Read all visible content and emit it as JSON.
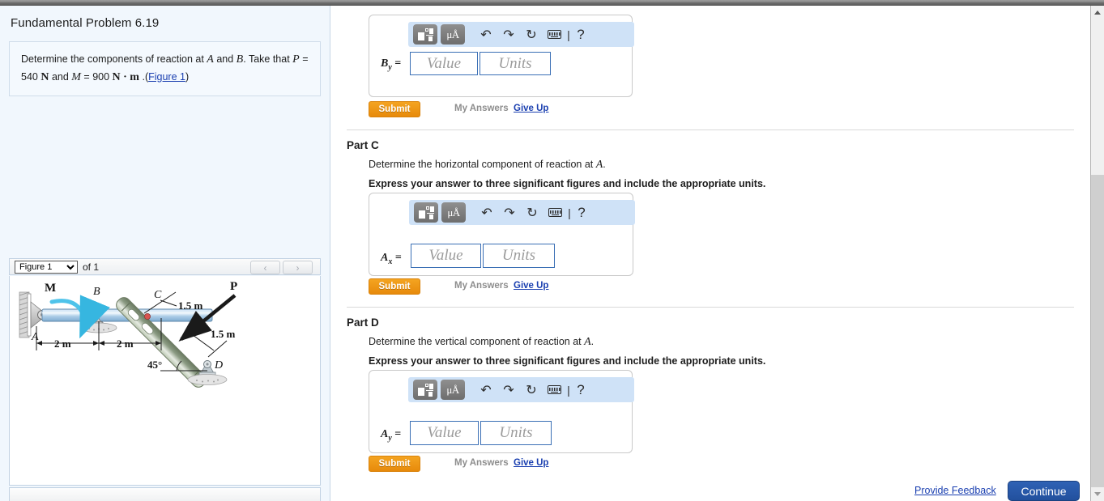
{
  "window": {
    "scrollbar": {
      "up_icon": "chevron-up-icon",
      "down_icon": "chevron-down-icon"
    }
  },
  "left_panel": {
    "problem_title": "Fundamental Problem 6.19",
    "problem_statement_html": "Determine the components of reaction at <span class=\"mvar\">A</span> and <span class=\"mvar\">B</span>. Take that <span class=\"mvar\">P</span> = 540 <span class=\"mbold\">N</span> and <span class=\"mvar\">M</span> = 900 <span class=\"mbold\">N &middot; m</span> .",
    "figure_link_label": "Figure 1",
    "figure_link_open": "(",
    "figure_link_close": ")",
    "figure_select_value": "Figure 1",
    "figure_select_options": [
      "Figure 1"
    ],
    "figure_count_label": "of 1",
    "prev_figure_icon": "chevron-left-icon",
    "next_figure_icon": "chevron-right-icon",
    "figure": {
      "labels": {
        "moment": "M",
        "point_a": "A",
        "point_b": "B",
        "point_c": "C",
        "point_d": "D",
        "force_p": "P",
        "dim_left": "2 m",
        "dim_right": "2 m",
        "dim_c": "1.5 m",
        "dim_d": "1.5 m",
        "angle": "45°"
      }
    }
  },
  "main": {
    "toolbar": {
      "template_icon": "math-template-icon",
      "units_icon": "micro-angstrom-units-icon",
      "undo_icon": "undo-icon",
      "redo_icon": "redo-icon",
      "reset_icon": "reset-icon",
      "keyboard_icon": "keyboard-icon",
      "separator": "|",
      "help_icon": "?"
    },
    "field_placeholders": {
      "value": "Value",
      "units": "Units"
    },
    "actions": {
      "submit": "Submit",
      "my_answers": "My Answers",
      "give_up": "Give Up"
    },
    "parts": [
      {
        "id": "part-b",
        "heading": "",
        "prompt": "",
        "instruction": "",
        "answer_label_base": "B",
        "answer_label_sub": "y",
        "answer_equals": "="
      },
      {
        "id": "part-c",
        "heading": "Part C",
        "prompt_pre": "Determine the horizontal component of reaction at ",
        "prompt_var": "A",
        "prompt_post": ".",
        "instruction": "Express your answer to three significant figures and include the appropriate units.",
        "answer_label_base": "A",
        "answer_label_sub": "x",
        "answer_equals": "="
      },
      {
        "id": "part-d",
        "heading": "Part D",
        "prompt_pre": "Determine the vertical component of reaction at ",
        "prompt_var": "A",
        "prompt_post": ".",
        "instruction": "Express your answer to three significant figures and include the appropriate units.",
        "answer_label_base": "A",
        "answer_label_sub": "y",
        "answer_equals": "="
      }
    ],
    "footer": {
      "provide_feedback": "Provide Feedback",
      "continue": "Continue"
    }
  },
  "colors": {
    "accent_orange": "#e78a0b",
    "link_blue": "#1a3fb0",
    "toolbar_blue": "#cfe2f7",
    "continue_blue": "#2f62b5",
    "panel_bg": "#f1f7fd"
  }
}
